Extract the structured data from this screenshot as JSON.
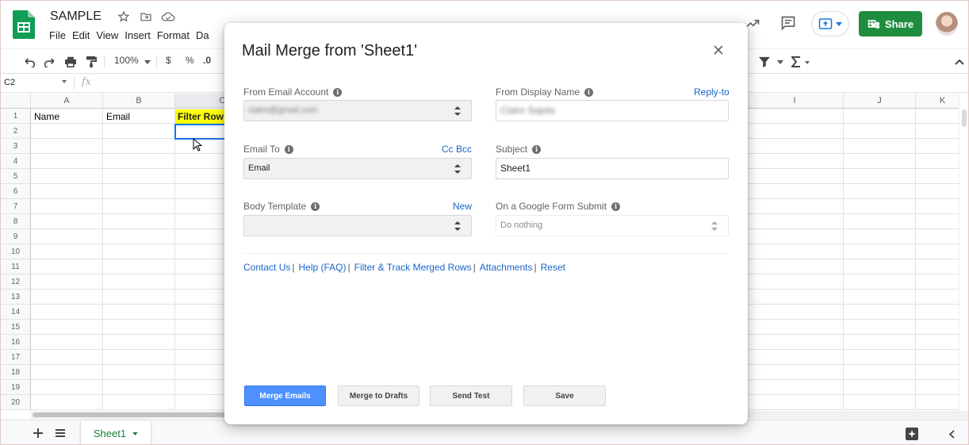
{
  "app": {
    "doc_title": "SAMPLE",
    "menu": [
      "File",
      "Edit",
      "View",
      "Insert",
      "Format",
      "Da"
    ],
    "share_label": "Share"
  },
  "toolbar": {
    "zoom": "100%",
    "currency": "$",
    "percent": "%",
    "decimal": ".0"
  },
  "formula_bar": {
    "cell_ref": "C2",
    "fx": "fx"
  },
  "grid": {
    "columns": [
      "A",
      "B",
      "C",
      "I",
      "J",
      "K"
    ],
    "rows": [
      "1",
      "2",
      "3",
      "4",
      "5",
      "6",
      "7",
      "8",
      "9",
      "10",
      "11",
      "12",
      "13",
      "14",
      "15",
      "16",
      "17",
      "18",
      "19",
      "20"
    ],
    "cells": {
      "A1": "Name",
      "B1": "Email",
      "C1": "Filter Row"
    }
  },
  "sheet_tab": {
    "name": "Sheet1"
  },
  "dialog": {
    "title": "Mail Merge from 'Sheet1'",
    "from_account": {
      "label": "From Email Account",
      "value": "claire@gmail.com"
    },
    "display_name": {
      "label": "From Display Name",
      "link": "Reply-to",
      "value": "Claire Sajota"
    },
    "email_to": {
      "label": "Email To",
      "link": "Cc Bcc",
      "value": "Email"
    },
    "subject": {
      "label": "Subject",
      "value": "Sheet1"
    },
    "body_template": {
      "label": "Body Template",
      "link": "New",
      "value": ""
    },
    "form_submit": {
      "label": "On a Google Form Submit",
      "value": "Do nothing"
    },
    "links": [
      "Contact Us",
      "Help (FAQ)",
      "Filter & Track Merged Rows",
      "Attachments",
      "Reset"
    ],
    "link_separator": "|",
    "buttons": {
      "merge": "Merge Emails",
      "drafts": "Merge to Drafts",
      "test": "Send Test",
      "save": "Save"
    }
  },
  "colors": {
    "share_green": "#1e8e3e",
    "primary_button": "#4d90fe",
    "link_blue": "#1a65c9",
    "filter_highlight": "#ffff00",
    "selection_blue": "#1a73e8",
    "tab_green": "#188038"
  }
}
